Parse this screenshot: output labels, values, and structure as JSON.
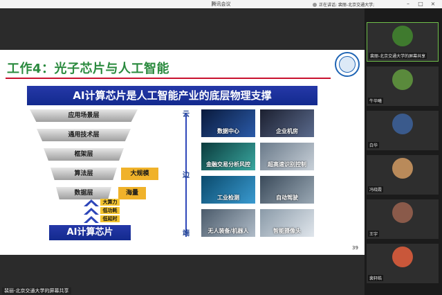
{
  "window": {
    "title": "腾讯会议",
    "speaking": "正在讲话: 裴丽-北京交通大学;"
  },
  "slide": {
    "title": "工作4：光子芯片与人工智能",
    "banner": "AI计算芯片是人工智能产业的底层物理支撑",
    "layers": [
      "应用场景层",
      "通用技术层",
      "框架层",
      "算法层",
      "数据层"
    ],
    "tags": [
      "大规模",
      "海量"
    ],
    "advantages": [
      "大算力",
      "低功耗",
      "低延时"
    ],
    "chip": "AI计算芯片",
    "axis": [
      "云",
      "边",
      "端"
    ],
    "images": [
      "数据中心",
      "企业机房",
      "金融交易分析风控",
      "超高速识别控制",
      "工业检测",
      "自动驾驶",
      "无人装备/机器人",
      "智能摄像头"
    ],
    "page": "39"
  },
  "share_label": "裴丽-北京交通大学的屏幕共享",
  "participants": [
    {
      "name": "裴丽-北京交通大学的屏幕共享",
      "color": "#3f7a2e"
    },
    {
      "name": "牛毕曦",
      "color": "#5a8a3c"
    },
    {
      "name": "白华",
      "color": "#3a5a8c"
    },
    {
      "name": "冯晓霞",
      "color": "#b98a5a"
    },
    {
      "name": "王宇",
      "color": "#8a5a4a"
    },
    {
      "name": "裴轩皓",
      "color": "#c9573a"
    }
  ]
}
